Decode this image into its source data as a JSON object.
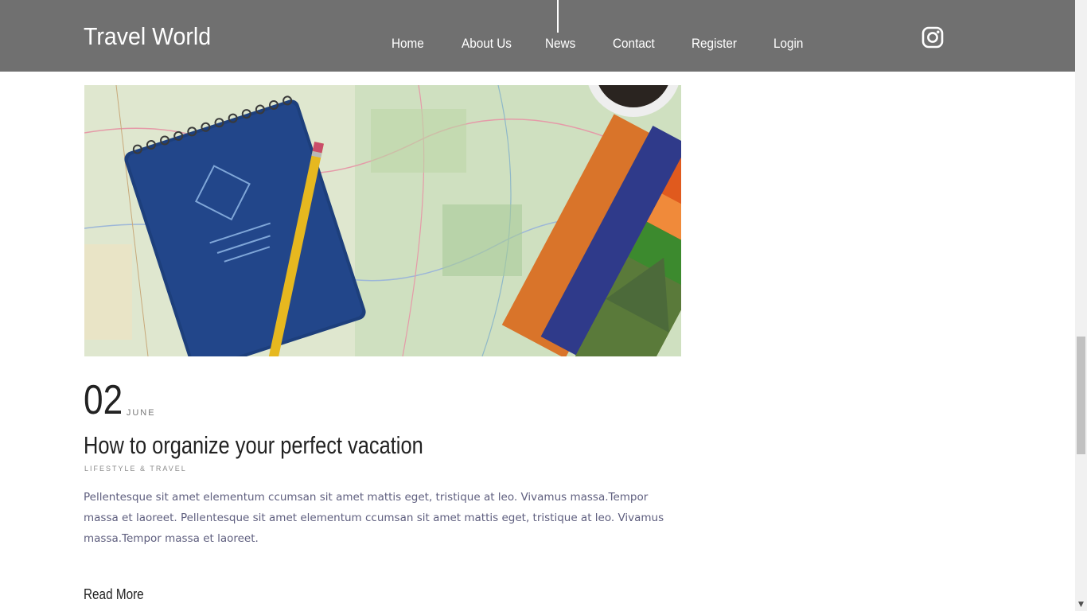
{
  "brand": {
    "name": "Travel World"
  },
  "nav": {
    "items": [
      {
        "label": "Home"
      },
      {
        "label": "About Us"
      },
      {
        "label": "News",
        "active": true
      },
      {
        "label": "Contact"
      },
      {
        "label": "Register"
      },
      {
        "label": "Login"
      }
    ],
    "social_icon": "instagram-icon"
  },
  "post": {
    "image_alt": "Notebook, pencil and travel brochures on a map",
    "day": "02",
    "month": "JUNE",
    "title": "How to organize your perfect vacation",
    "category": "LIFESTYLE & TRAVEL",
    "excerpt": "Pellentesque sit amet elementum ccumsan sit amet mattis eget, tristique at leo. Vivamus massa.Tempor massa et laoreet. Pellentesque sit amet elementum ccumsan sit amet mattis eget, tristique at leo. Vivamus massa.Tempor massa et laoreet.",
    "read_more": "Read More"
  },
  "colors": {
    "header_bg": "#707070",
    "text_dark": "#222222",
    "excerpt_text": "#5e5e7e"
  }
}
